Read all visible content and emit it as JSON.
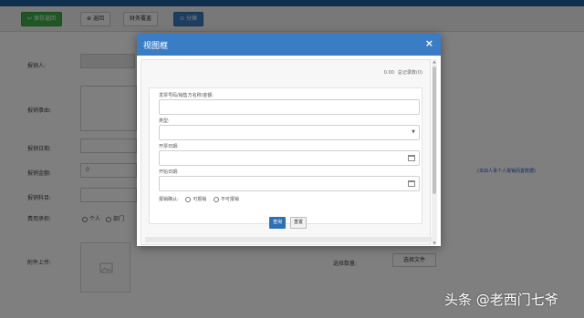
{
  "toolbar": {
    "save_label": "保存返回",
    "back_label": "返回",
    "finance_label": "财务覆盖",
    "share_label": "分摊"
  },
  "form": {
    "applicant_label": "报销人:",
    "reason_label": "报销事由:",
    "date_label": "报销日期:",
    "amount_label": "报销金额:",
    "amount_value": "0",
    "account_label": "报销科目:",
    "fee_label": "费用承担:",
    "fee_personal": "个人",
    "fee_department": "部门",
    "attachment_label": "附件上传:",
    "select_file_label": "选择文件",
    "file_count_label": "选择数量:",
    "amount_note": "(本由人事个人报销而置数据)"
  },
  "modal": {
    "title": "视图框",
    "close_icon": "×",
    "summary_amount": "0.00",
    "summary_count": "总记录数(0)",
    "fields": {
      "search_label": "发票号码/销售方名称/金额:",
      "type_label": "类型:",
      "start_date_label": "开票日期:",
      "end_date_label": "开始日期:",
      "reimbursable_label": "报销确认:",
      "option_reimbursable": "可报销",
      "option_not_reimbursable": "不可报销"
    },
    "buttons": {
      "query_label": "查询",
      "reset_label": "重置"
    }
  },
  "watermark": "头条 @老西门七爷",
  "colors": {
    "header_blue": "#3b7dc4",
    "save_green": "#3fae49",
    "query_blue": "#2f6fb5"
  }
}
